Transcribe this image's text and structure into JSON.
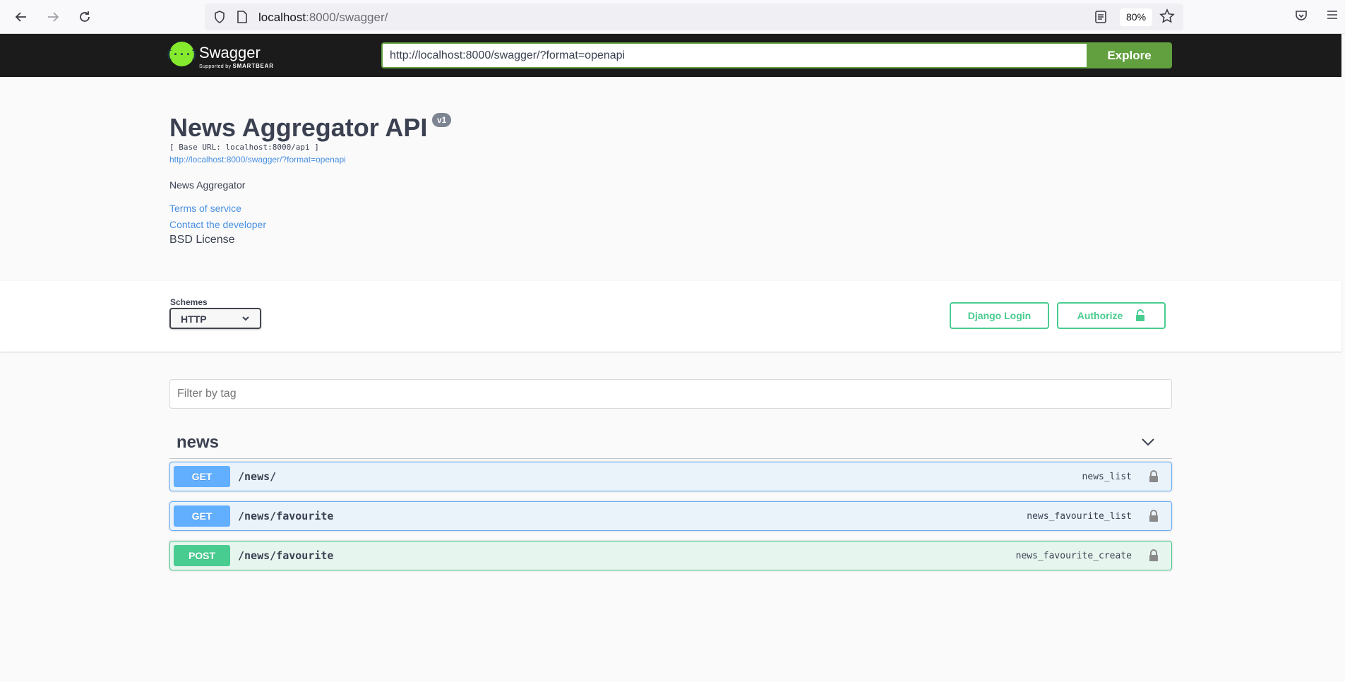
{
  "browser": {
    "url_host": "localhost",
    "url_rest": ":8000/swagger/",
    "zoom": "80%"
  },
  "topbar": {
    "logo_word": "Swagger",
    "logo_sub_prefix": "Supported by",
    "logo_sub_brand": "SMARTBEAR",
    "spec_url": "http://localhost:8000/swagger/?format=openapi",
    "explore_label": "Explore"
  },
  "info": {
    "title": "News Aggregator API",
    "version": "v1",
    "base_url": "[ Base URL: localhost:8000/api ]",
    "spec_link": "http://localhost:8000/swagger/?format=openapi",
    "description": "News Aggregator",
    "terms": "Terms of service",
    "contact": "Contact the developer",
    "license": "BSD License"
  },
  "schemes": {
    "label": "Schemes",
    "selected": "HTTP"
  },
  "auth": {
    "django_login": "Django Login",
    "authorize": "Authorize"
  },
  "filter": {
    "placeholder": "Filter by tag"
  },
  "tag": {
    "name": "news",
    "operations": [
      {
        "method": "GET",
        "path": "/news/",
        "operation_id": "news_list"
      },
      {
        "method": "GET",
        "path": "/news/favourite",
        "operation_id": "news_favourite_list"
      },
      {
        "method": "POST",
        "path": "/news/favourite",
        "operation_id": "news_favourite_create"
      }
    ]
  },
  "colors": {
    "get": "#61affe",
    "post": "#49cc90",
    "explore": "#62a03f",
    "link": "#4990e2"
  }
}
